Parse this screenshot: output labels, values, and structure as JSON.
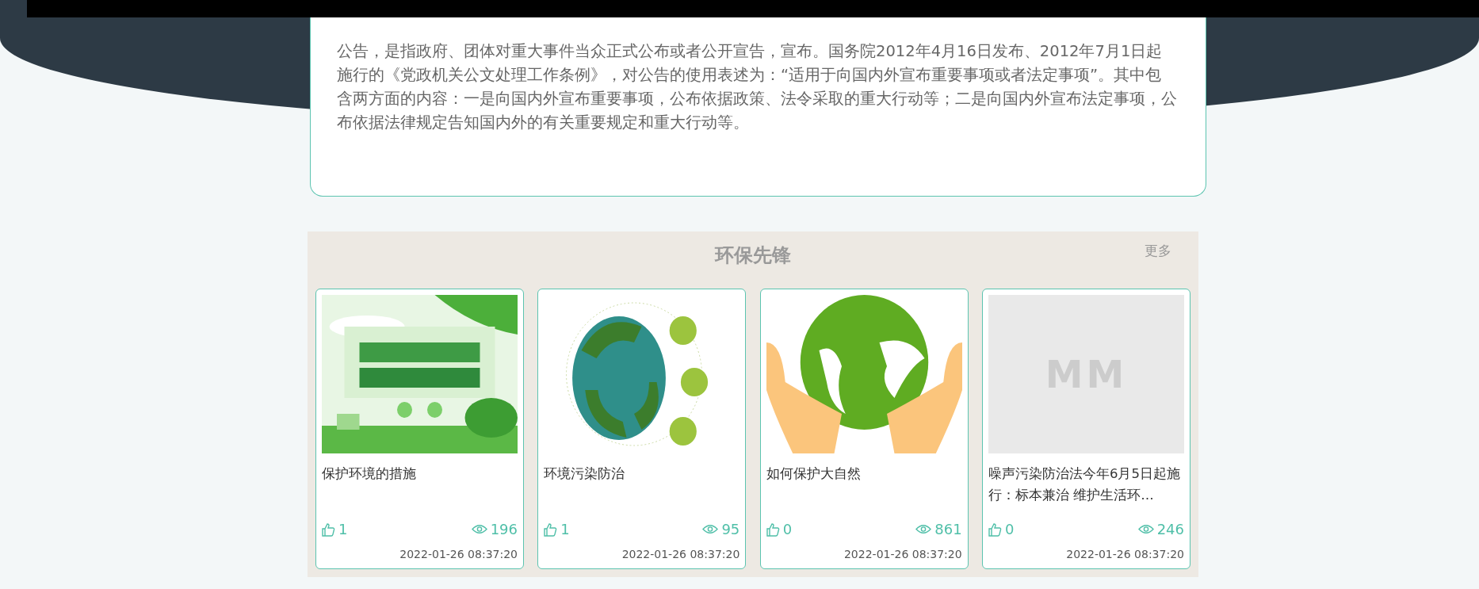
{
  "notice": {
    "text": "公告，是指政府、团体对重大事件当众正式公布或者公开宣告，宣布。国务院2012年4月16日发布、2012年7月1日起施行的《党政机关公文处理工作条例》，对公告的使用表述为：“适用于向国内外宣布重要事项或者法定事项”。其中包含两方面的内容：一是向国内外宣布重要事项，公布依据政策、法令采取的重大行动等；二是向国内外宣布法定事项，公布依据法律规定告知国内外的有关重要规定和重大行动等。"
  },
  "section": {
    "title": "环保先锋",
    "more": "更多",
    "cards": [
      {
        "title": "保护环境的措施",
        "likes": "1",
        "views": "196",
        "date": "2022-01-26 08:37:20"
      },
      {
        "title": "环境污染防治",
        "likes": "1",
        "views": "95",
        "date": "2022-01-26 08:37:20"
      },
      {
        "title": "如何保护大自然",
        "likes": "0",
        "views": "861",
        "date": "2022-01-26 08:37:20"
      },
      {
        "image": {
          "kind": "placeholder",
          "text": "MM"
        },
        "title": "噪声污染防治法今年6月5日起施行：标本兼治 维护生活环…",
        "likes": "0",
        "views": "246",
        "date": "2022-01-26 08:37:20"
      }
    ]
  }
}
